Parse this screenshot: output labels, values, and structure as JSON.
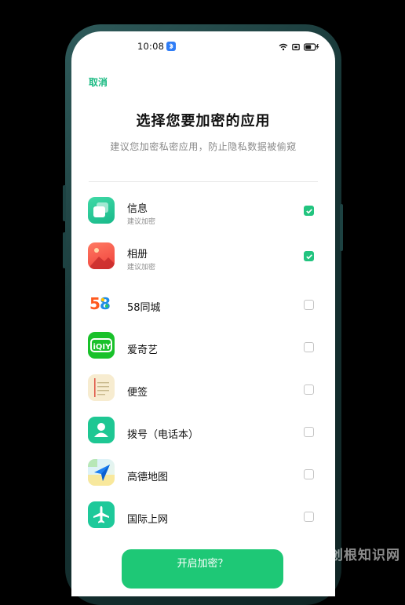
{
  "status_bar": {
    "time": "10:08"
  },
  "header": {
    "cancel_label": "取消",
    "title": "选择您要加密的应用",
    "subtitle": "建议您加密私密应用，防止隐私数据被偷窥"
  },
  "apps": [
    {
      "name": "信息",
      "sub": "建议加密",
      "checked": true,
      "icon": "messages-icon"
    },
    {
      "name": "相册",
      "sub": "建议加密",
      "checked": true,
      "icon": "photos-icon"
    },
    {
      "name": "58同城",
      "sub": "",
      "checked": false,
      "icon": "58-icon",
      "icon_text": "58"
    },
    {
      "name": "爱奇艺",
      "sub": "",
      "checked": false,
      "icon": "iqiyi-icon",
      "icon_text": "iQIY"
    },
    {
      "name": "便签",
      "sub": "",
      "checked": false,
      "icon": "notes-icon"
    },
    {
      "name": "拨号（电话本）",
      "sub": "",
      "checked": false,
      "icon": "contacts-icon"
    },
    {
      "name": "高德地图",
      "sub": "",
      "checked": false,
      "icon": "amap-icon"
    },
    {
      "name": "国际上网",
      "sub": "",
      "checked": false,
      "icon": "airplane-icon"
    }
  ],
  "footer": {
    "button_label": "开启加密？"
  },
  "watermark": "爱创根知识网",
  "colors": {
    "accent": "#1ec876",
    "checkbox_checked": "#22c47f"
  }
}
